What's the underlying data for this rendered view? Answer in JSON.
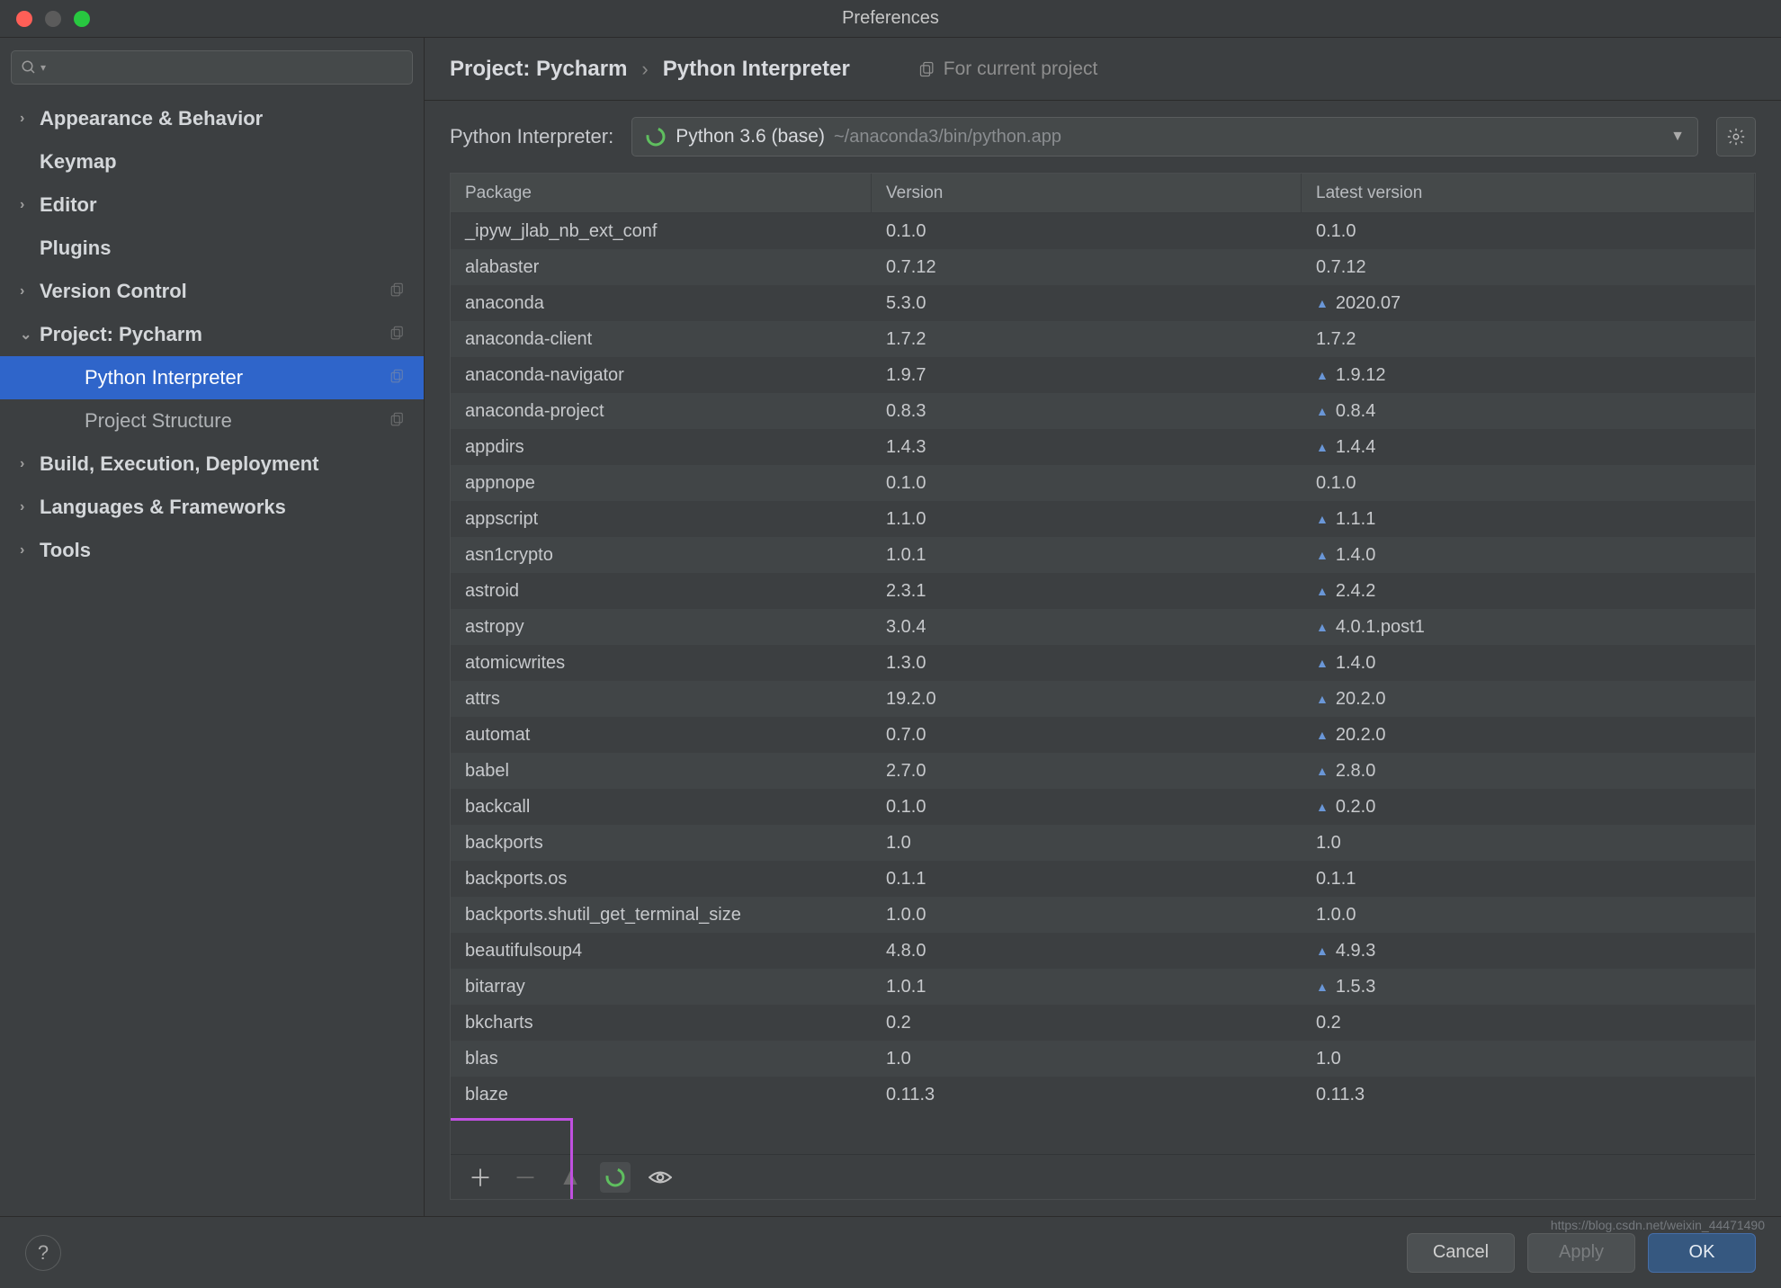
{
  "window": {
    "title": "Preferences"
  },
  "sidebar": {
    "items": [
      {
        "label": "Appearance & Behavior",
        "expandable": true,
        "bold": true
      },
      {
        "label": "Keymap",
        "expandable": false,
        "bold": true
      },
      {
        "label": "Editor",
        "expandable": true,
        "bold": true
      },
      {
        "label": "Plugins",
        "expandable": false,
        "bold": true
      },
      {
        "label": "Version Control",
        "expandable": true,
        "bold": true,
        "copy": true
      },
      {
        "label": "Project: Pycharm",
        "expandable": true,
        "expanded": true,
        "bold": true,
        "copy": true
      },
      {
        "label": "Python Interpreter",
        "expandable": false,
        "sub": true,
        "selected": true,
        "copy": true
      },
      {
        "label": "Project Structure",
        "expandable": false,
        "sub": true,
        "copy": true
      },
      {
        "label": "Build, Execution, Deployment",
        "expandable": true,
        "bold": true
      },
      {
        "label": "Languages & Frameworks",
        "expandable": true,
        "bold": true
      },
      {
        "label": "Tools",
        "expandable": true,
        "bold": true
      }
    ]
  },
  "breadcrumb": {
    "project": "Project: Pycharm",
    "page": "Python Interpreter",
    "for_current": "For current project"
  },
  "interpreter": {
    "label": "Python Interpreter:",
    "name": "Python 3.6 (base)",
    "path": "~/anaconda3/bin/python.app"
  },
  "columns": {
    "package": "Package",
    "version": "Version",
    "latest": "Latest version"
  },
  "packages": [
    {
      "name": "_ipyw_jlab_nb_ext_conf",
      "version": "0.1.0",
      "latest": "0.1.0",
      "upgrade": false
    },
    {
      "name": "alabaster",
      "version": "0.7.12",
      "latest": "0.7.12",
      "upgrade": false
    },
    {
      "name": "anaconda",
      "version": "5.3.0",
      "latest": "2020.07",
      "upgrade": true
    },
    {
      "name": "anaconda-client",
      "version": "1.7.2",
      "latest": "1.7.2",
      "upgrade": false
    },
    {
      "name": "anaconda-navigator",
      "version": "1.9.7",
      "latest": "1.9.12",
      "upgrade": true
    },
    {
      "name": "anaconda-project",
      "version": "0.8.3",
      "latest": "0.8.4",
      "upgrade": true
    },
    {
      "name": "appdirs",
      "version": "1.4.3",
      "latest": "1.4.4",
      "upgrade": true
    },
    {
      "name": "appnope",
      "version": "0.1.0",
      "latest": "0.1.0",
      "upgrade": false
    },
    {
      "name": "appscript",
      "version": "1.1.0",
      "latest": "1.1.1",
      "upgrade": true
    },
    {
      "name": "asn1crypto",
      "version": "1.0.1",
      "latest": "1.4.0",
      "upgrade": true
    },
    {
      "name": "astroid",
      "version": "2.3.1",
      "latest": "2.4.2",
      "upgrade": true
    },
    {
      "name": "astropy",
      "version": "3.0.4",
      "latest": "4.0.1.post1",
      "upgrade": true
    },
    {
      "name": "atomicwrites",
      "version": "1.3.0",
      "latest": "1.4.0",
      "upgrade": true
    },
    {
      "name": "attrs",
      "version": "19.2.0",
      "latest": "20.2.0",
      "upgrade": true
    },
    {
      "name": "automat",
      "version": "0.7.0",
      "latest": "20.2.0",
      "upgrade": true
    },
    {
      "name": "babel",
      "version": "2.7.0",
      "latest": "2.8.0",
      "upgrade": true
    },
    {
      "name": "backcall",
      "version": "0.1.0",
      "latest": "0.2.0",
      "upgrade": true
    },
    {
      "name": "backports",
      "version": "1.0",
      "latest": "1.0",
      "upgrade": false
    },
    {
      "name": "backports.os",
      "version": "0.1.1",
      "latest": "0.1.1",
      "upgrade": false
    },
    {
      "name": "backports.shutil_get_terminal_size",
      "version": "1.0.0",
      "latest": "1.0.0",
      "upgrade": false
    },
    {
      "name": "beautifulsoup4",
      "version": "4.8.0",
      "latest": "4.9.3",
      "upgrade": true
    },
    {
      "name": "bitarray",
      "version": "1.0.1",
      "latest": "1.5.3",
      "upgrade": true
    },
    {
      "name": "bkcharts",
      "version": "0.2",
      "latest": "0.2",
      "upgrade": false
    },
    {
      "name": "blas",
      "version": "1.0",
      "latest": "1.0",
      "upgrade": false
    },
    {
      "name": "blaze",
      "version": "0.11.3",
      "latest": "0.11.3",
      "upgrade": false
    }
  ],
  "footer": {
    "cancel": "Cancel",
    "apply": "Apply",
    "ok": "OK"
  },
  "watermark": "https://blog.csdn.net/weixin_44471490"
}
